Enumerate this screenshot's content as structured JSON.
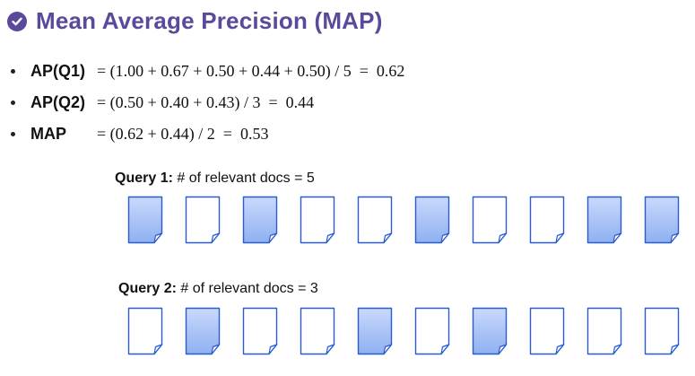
{
  "title": "Mean Average Precision (MAP)",
  "bullets": [
    {
      "label": "AP(Q1)",
      "equation": "= (1.00 + 0.67 + 0.50 + 0.44 + 0.50) / 5  =  0.62"
    },
    {
      "label": "AP(Q2)",
      "equation": "= (0.50 + 0.40 + 0.43) / 3  =  0.44"
    },
    {
      "label": "MAP",
      "equation": "= (0.62 + 0.44) / 2  =  0.53"
    }
  ],
  "queries": [
    {
      "name": "Query 1:",
      "desc": " # of relevant docs = 5",
      "relevance": [
        1,
        0,
        1,
        0,
        0,
        1,
        0,
        0,
        1,
        1
      ]
    },
    {
      "name": "Query 2:",
      "desc": " # of relevant docs = 3",
      "relevance": [
        0,
        1,
        0,
        0,
        1,
        0,
        1,
        0,
        0,
        0
      ]
    }
  ],
  "colors": {
    "title": "#5b4a9c",
    "relevant_fill": "#8fb0f0",
    "doc_stroke": "#2a5bd6"
  }
}
